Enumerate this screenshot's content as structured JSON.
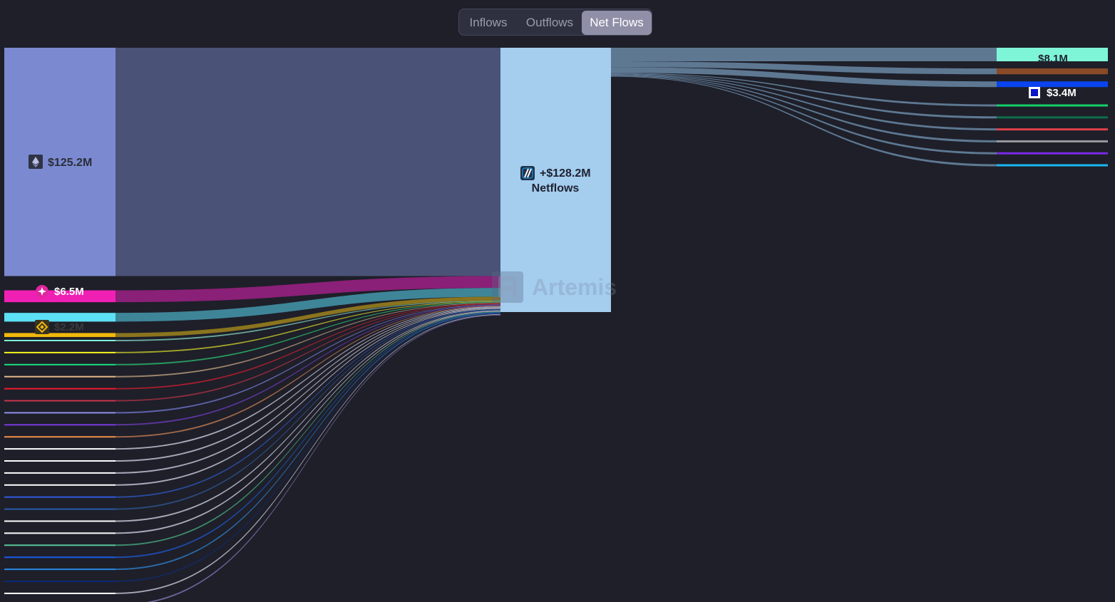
{
  "tabs": {
    "inflows": "Inflows",
    "outflows": "Outflows",
    "netflows": "Net Flows",
    "active": "netflows"
  },
  "watermark": "Artemis",
  "chart_data": {
    "type": "sankey",
    "unit": "USD",
    "center": {
      "label": "+$128.2M",
      "sublabel": "Netflows",
      "color": "#a4cdee",
      "icon": "arbitrum-icon"
    },
    "sources": [
      {
        "value": 125.2,
        "label": "$125.2M",
        "color": "#7b8ad0",
        "link_color": "#4b5277",
        "icon": "ethereum-icon"
      },
      {
        "value": 6.5,
        "label": "$6.5M",
        "color": "#f020b4",
        "link_color": "#8a2077",
        "icon": "spark-icon"
      },
      {
        "value": 4.8,
        "label": "",
        "color": "#5ce0f5",
        "link_color": "#3e8598"
      },
      {
        "value": 2.2,
        "label": "$2.2M",
        "color": "#f0b90b",
        "link_color": "#8a741e",
        "icon": "bnb-icon"
      },
      {
        "value": 0.6,
        "label": "",
        "color": "#7ff5d8",
        "link_color": "#6aa99c"
      },
      {
        "value": 0.6,
        "label": "",
        "color": "#f5f51c",
        "link_color": "#a3a62a"
      },
      {
        "value": 0.6,
        "label": "",
        "color": "#18e07a",
        "link_color": "#289a5e"
      },
      {
        "value": 0.6,
        "label": "",
        "color": "#e6b98a",
        "link_color": "#9a826a"
      },
      {
        "value": 0.6,
        "label": "",
        "color": "#f01a2e",
        "link_color": "#a01f2e"
      },
      {
        "value": 0.6,
        "label": "",
        "color": "#c8354a",
        "link_color": "#8a2d3e"
      },
      {
        "value": 0.6,
        "label": "",
        "color": "#8f8fe8",
        "link_color": "#5e63a8"
      },
      {
        "value": 0.6,
        "label": "",
        "color": "#7a3ae0",
        "link_color": "#5a3598"
      },
      {
        "value": 0.6,
        "label": "",
        "color": "#f0904a",
        "link_color": "#a0684a"
      },
      {
        "value": 0.6,
        "label": "",
        "color": "#ffffff",
        "link_color": "#a6a8b8"
      },
      {
        "value": 0.6,
        "label": "",
        "color": "#ffffff",
        "link_color": "#a6a8b8"
      },
      {
        "value": 0.6,
        "label": "",
        "color": "#ffffff",
        "link_color": "#a6a8b8"
      },
      {
        "value": 0.6,
        "label": "",
        "color": "#ffffff",
        "link_color": "#a6a8b8"
      },
      {
        "value": 0.6,
        "label": "",
        "color": "#2e5ae0",
        "link_color": "#2b4a9c"
      },
      {
        "value": 0.6,
        "label": "",
        "color": "#2a5aa8",
        "link_color": "#2b4a78"
      },
      {
        "value": 0.6,
        "label": "",
        "color": "#ffffff",
        "link_color": "#a6a8b8"
      },
      {
        "value": 0.6,
        "label": "",
        "color": "#ffffff",
        "link_color": "#a6a8b8"
      },
      {
        "value": 0.6,
        "label": "",
        "color": "#5ac89a",
        "link_color": "#3e8a6c"
      },
      {
        "value": 0.6,
        "label": "",
        "color": "#1a5ae8",
        "link_color": "#1e4aa8"
      },
      {
        "value": 0.6,
        "label": "",
        "color": "#2a88e8",
        "link_color": "#2a6aa8"
      },
      {
        "value": 0.6,
        "label": "",
        "color": "#0a2a78",
        "link_color": "#14285a"
      },
      {
        "value": 0.6,
        "label": "",
        "color": "#ffffff",
        "link_color": "#a6a8b8"
      },
      {
        "value": 0.6,
        "label": "",
        "color": "#a090e0",
        "link_color": "#6e6498"
      }
    ],
    "targets": [
      {
        "value": 8.1,
        "label": "$8.1M",
        "color": "#7ff5d8",
        "icon": ""
      },
      {
        "value": 3.5,
        "label": "",
        "color": "#8a4a28",
        "icon": ""
      },
      {
        "value": 3.4,
        "label": "$3.4M",
        "color": "#0a44f0",
        "icon": "square-icon"
      },
      {
        "value": 0.6,
        "label": "",
        "color": "#14d068",
        "icon": ""
      },
      {
        "value": 0.6,
        "label": "",
        "color": "#0e6e4a",
        "icon": ""
      },
      {
        "value": 0.6,
        "label": "",
        "color": "#e0404a",
        "icon": ""
      },
      {
        "value": 0.6,
        "label": "",
        "color": "#9a9aa0",
        "icon": ""
      },
      {
        "value": 0.6,
        "label": "",
        "color": "#7a2ae8",
        "icon": ""
      },
      {
        "value": 0.6,
        "label": "",
        "color": "#18b8f0",
        "icon": ""
      }
    ],
    "outflow_link_color": "#5e7892"
  }
}
